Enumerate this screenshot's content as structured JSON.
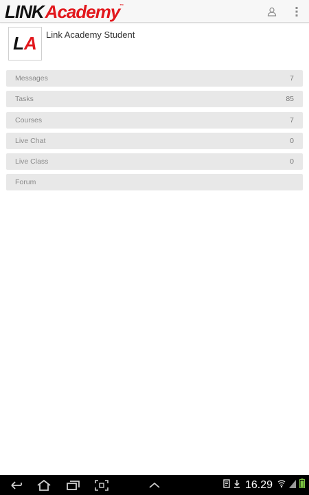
{
  "app": {
    "logo_link": "LINK",
    "logo_academy": "Academy",
    "logo_tm": "™"
  },
  "profile": {
    "avatar_l": "L",
    "avatar_a": "A",
    "name": "Link Academy Student"
  },
  "menu": [
    {
      "label": "Messages",
      "count": "7"
    },
    {
      "label": "Tasks",
      "count": "85"
    },
    {
      "label": "Courses",
      "count": "7"
    },
    {
      "label": "Live Chat",
      "count": "0"
    },
    {
      "label": "Live Class",
      "count": "0"
    },
    {
      "label": "Forum",
      "count": ""
    }
  ],
  "statusbar": {
    "time": "16.29"
  },
  "colors": {
    "brand_red": "#e2171c",
    "menu_bg": "#e8e8e8",
    "appbar_bg": "#f7f7f7"
  },
  "icons": {
    "appbar": [
      "user-icon",
      "overflow-menu-icon"
    ],
    "nav": [
      "back-icon",
      "home-icon",
      "recent-apps-icon",
      "screenshot-icon",
      "chevron-up-icon"
    ],
    "status": [
      "notification-icon",
      "download-icon",
      "wifi-icon",
      "signal-icon",
      "battery-icon"
    ]
  }
}
